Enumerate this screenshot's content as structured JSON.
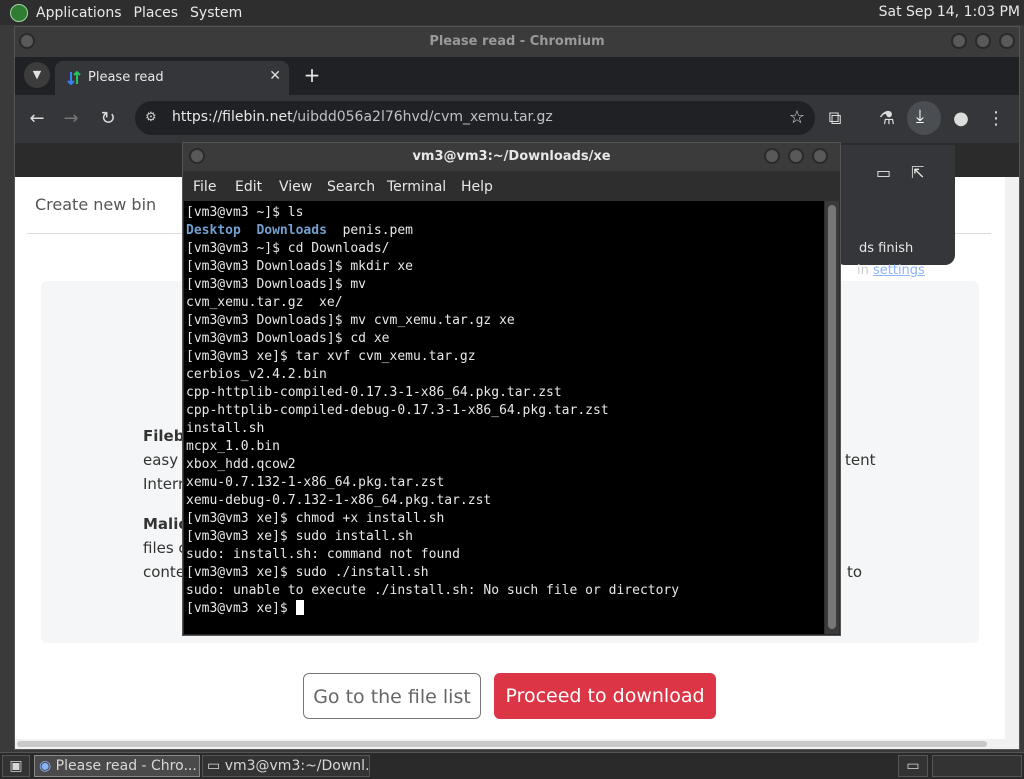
{
  "top_panel": {
    "applications": "Applications",
    "places": "Places",
    "system": "System",
    "clock": "Sat Sep 14,  1:03 PM"
  },
  "browser": {
    "window_title": "Please read - Chromium",
    "tab": {
      "title": "Please read",
      "close": "✕"
    },
    "toolbar": {
      "url_host": "https://filebin.net",
      "url_path": "/uibdd056a2l76hvd/cvm_xemu.tar.gz"
    },
    "download_bubble": {
      "line1": "ds finish",
      "line2_prefix": "in ",
      "line2_link": "settings"
    },
    "page": {
      "create_bin": "Create new bin",
      "fragments": {
        "filebin_bold": "Filebi",
        "easy": "easy t",
        "intern": "Interr",
        "malic_bold": "Malic",
        "files": "files c",
        "conte": "conte",
        "tent": "tent",
        "to": "to"
      },
      "btn_file_list": "Go to the file list",
      "btn_download": "Proceed to download"
    }
  },
  "terminal": {
    "title": "vm3@vm3:~/Downloads/xe",
    "menu": [
      "File",
      "Edit",
      "View",
      "Search",
      "Terminal",
      "Help"
    ],
    "lines": [
      "[vm3@vm3 ~]$ ls",
      "",
      "[vm3@vm3 ~]$ cd Downloads/",
      "[vm3@vm3 Downloads]$ mkdir xe",
      "[vm3@vm3 Downloads]$ mv",
      "cvm_xemu.tar.gz  xe/",
      "[vm3@vm3 Downloads]$ mv cvm_xemu.tar.gz xe",
      "[vm3@vm3 Downloads]$ cd xe",
      "[vm3@vm3 xe]$ tar xvf cvm_xemu.tar.gz",
      "cerbios_v2.4.2.bin",
      "cpp-httplib-compiled-0.17.3-1-x86_64.pkg.tar.zst",
      "cpp-httplib-compiled-debug-0.17.3-1-x86_64.pkg.tar.zst",
      "install.sh",
      "mcpx_1.0.bin",
      "xbox_hdd.qcow2",
      "xemu-0.7.132-1-x86_64.pkg.tar.zst",
      "xemu-debug-0.7.132-1-x86_64.pkg.tar.zst",
      "[vm3@vm3 xe]$ chmod +x install.sh",
      "[vm3@vm3 xe]$ sudo install.sh",
      "sudo: install.sh: command not found",
      "[vm3@vm3 xe]$ sudo ./install.sh",
      "sudo: unable to execute ./install.sh: No such file or directory",
      "[vm3@vm3 xe]$ "
    ],
    "ls_output": {
      "dir1": "Desktop",
      "dir2": "Downloads",
      "file": "penis.pem"
    }
  },
  "taskbar": {
    "task1": "Please read - Chro...",
    "task2": "vm3@vm3:~/Downl..."
  },
  "colors": {
    "accent_red": "#dc3545",
    "dir_blue": "#729fcf",
    "link_blue": "#8ab4f8"
  }
}
